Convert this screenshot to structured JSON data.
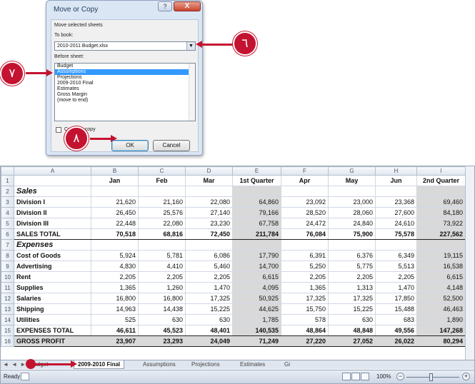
{
  "dialog": {
    "title": "Move or Copy",
    "help": "?",
    "close": "X",
    "move_label": "Move selected sheets",
    "to_book_label": "To book:",
    "to_book_value": "2010-2011 Budget.xlsx",
    "before_sheet_label": "Before sheet:",
    "sheets": [
      "Budget",
      "Assumptions",
      "Projections",
      "2009-2010 Final",
      "Estimates",
      "Gross Margin",
      "(move to end)"
    ],
    "selected_index": 1,
    "create_copy_label": "Create a copy",
    "ok": "OK",
    "cancel": "Cancel"
  },
  "callouts": {
    "six": "٦",
    "seven": "٧",
    "eight": "٨"
  },
  "sheet": {
    "col_headers": [
      "A",
      "B",
      "C",
      "D",
      "E",
      "F",
      "G",
      "H",
      "I"
    ],
    "rows": [
      {
        "n": "1",
        "type": "colh",
        "cells": [
          "",
          "Jan",
          "Feb",
          "Mar",
          "1st Quarter",
          "Apr",
          "May",
          "Jun",
          "2nd Quarter"
        ]
      },
      {
        "n": "2",
        "type": "sec",
        "cells": [
          "Sales",
          "",
          "",
          "",
          "",
          "",
          "",
          "",
          ""
        ]
      },
      {
        "n": "3",
        "type": "row",
        "cells": [
          "Division I",
          "21,620",
          "21,160",
          "22,080",
          "64,860",
          "23,092",
          "23,000",
          "23,368",
          "69,460"
        ]
      },
      {
        "n": "4",
        "type": "row",
        "cells": [
          "Division II",
          "26,450",
          "25,576",
          "27,140",
          "79,166",
          "28,520",
          "28,060",
          "27,600",
          "84,180"
        ]
      },
      {
        "n": "5",
        "type": "row",
        "cells": [
          "Division III",
          "22,448",
          "22,080",
          "23,230",
          "67,758",
          "24,472",
          "24,840",
          "24,610",
          "73,922"
        ]
      },
      {
        "n": "6",
        "type": "tot",
        "cells": [
          "SALES TOTAL",
          "70,518",
          "68,816",
          "72,450",
          "211,784",
          "76,084",
          "75,900",
          "75,578",
          "227,562"
        ]
      },
      {
        "n": "7",
        "type": "sec",
        "cells": [
          "Expenses",
          "",
          "",
          "",
          "",
          "",
          "",
          "",
          ""
        ]
      },
      {
        "n": "8",
        "type": "row",
        "cells": [
          "Cost of Goods",
          "5,924",
          "5,781",
          "6,086",
          "17,790",
          "6,391",
          "6,376",
          "6,349",
          "19,115"
        ]
      },
      {
        "n": "9",
        "type": "row",
        "cells": [
          "Advertising",
          "4,830",
          "4,410",
          "5,460",
          "14,700",
          "5,250",
          "5,775",
          "5,513",
          "16,538"
        ]
      },
      {
        "n": "10",
        "type": "row",
        "cells": [
          "Rent",
          "2,205",
          "2,205",
          "2,205",
          "6,615",
          "2,205",
          "2,205",
          "2,205",
          "6,615"
        ]
      },
      {
        "n": "11",
        "type": "row",
        "cells": [
          "Supplies",
          "1,365",
          "1,260",
          "1,470",
          "4,095",
          "1,365",
          "1,313",
          "1,470",
          "4,148"
        ]
      },
      {
        "n": "12",
        "type": "row",
        "cells": [
          "Salaries",
          "16,800",
          "16,800",
          "17,325",
          "50,925",
          "17,325",
          "17,325",
          "17,850",
          "52,500"
        ]
      },
      {
        "n": "13",
        "type": "row",
        "cells": [
          "Shipping",
          "14,963",
          "14,438",
          "15,225",
          "44,625",
          "15,750",
          "15,225",
          "15,488",
          "46,463"
        ]
      },
      {
        "n": "14",
        "type": "row",
        "cells": [
          "Utilities",
          "525",
          "630",
          "630",
          "1,785",
          "578",
          "630",
          "683",
          "1,890"
        ]
      },
      {
        "n": "15",
        "type": "tot",
        "cells": [
          "EXPENSES TOTAL",
          "46,611",
          "45,523",
          "48,401",
          "140,535",
          "48,864",
          "48,848",
          "49,556",
          "147,268"
        ]
      },
      {
        "n": "16",
        "type": "totg",
        "cells": [
          "GROSS PROFIT",
          "23,907",
          "23,293",
          "24,049",
          "71,249",
          "27,220",
          "27,052",
          "26,022",
          "80,294"
        ]
      }
    ],
    "tab_nav": "◄ ◄ ► ►",
    "tabs": [
      "Budget",
      "2009-2010 Final",
      "Assumptions",
      "Projections",
      "Estimates",
      "Gi"
    ],
    "active_tab": 1,
    "status_ready": "Ready",
    "zoom": "100%"
  }
}
